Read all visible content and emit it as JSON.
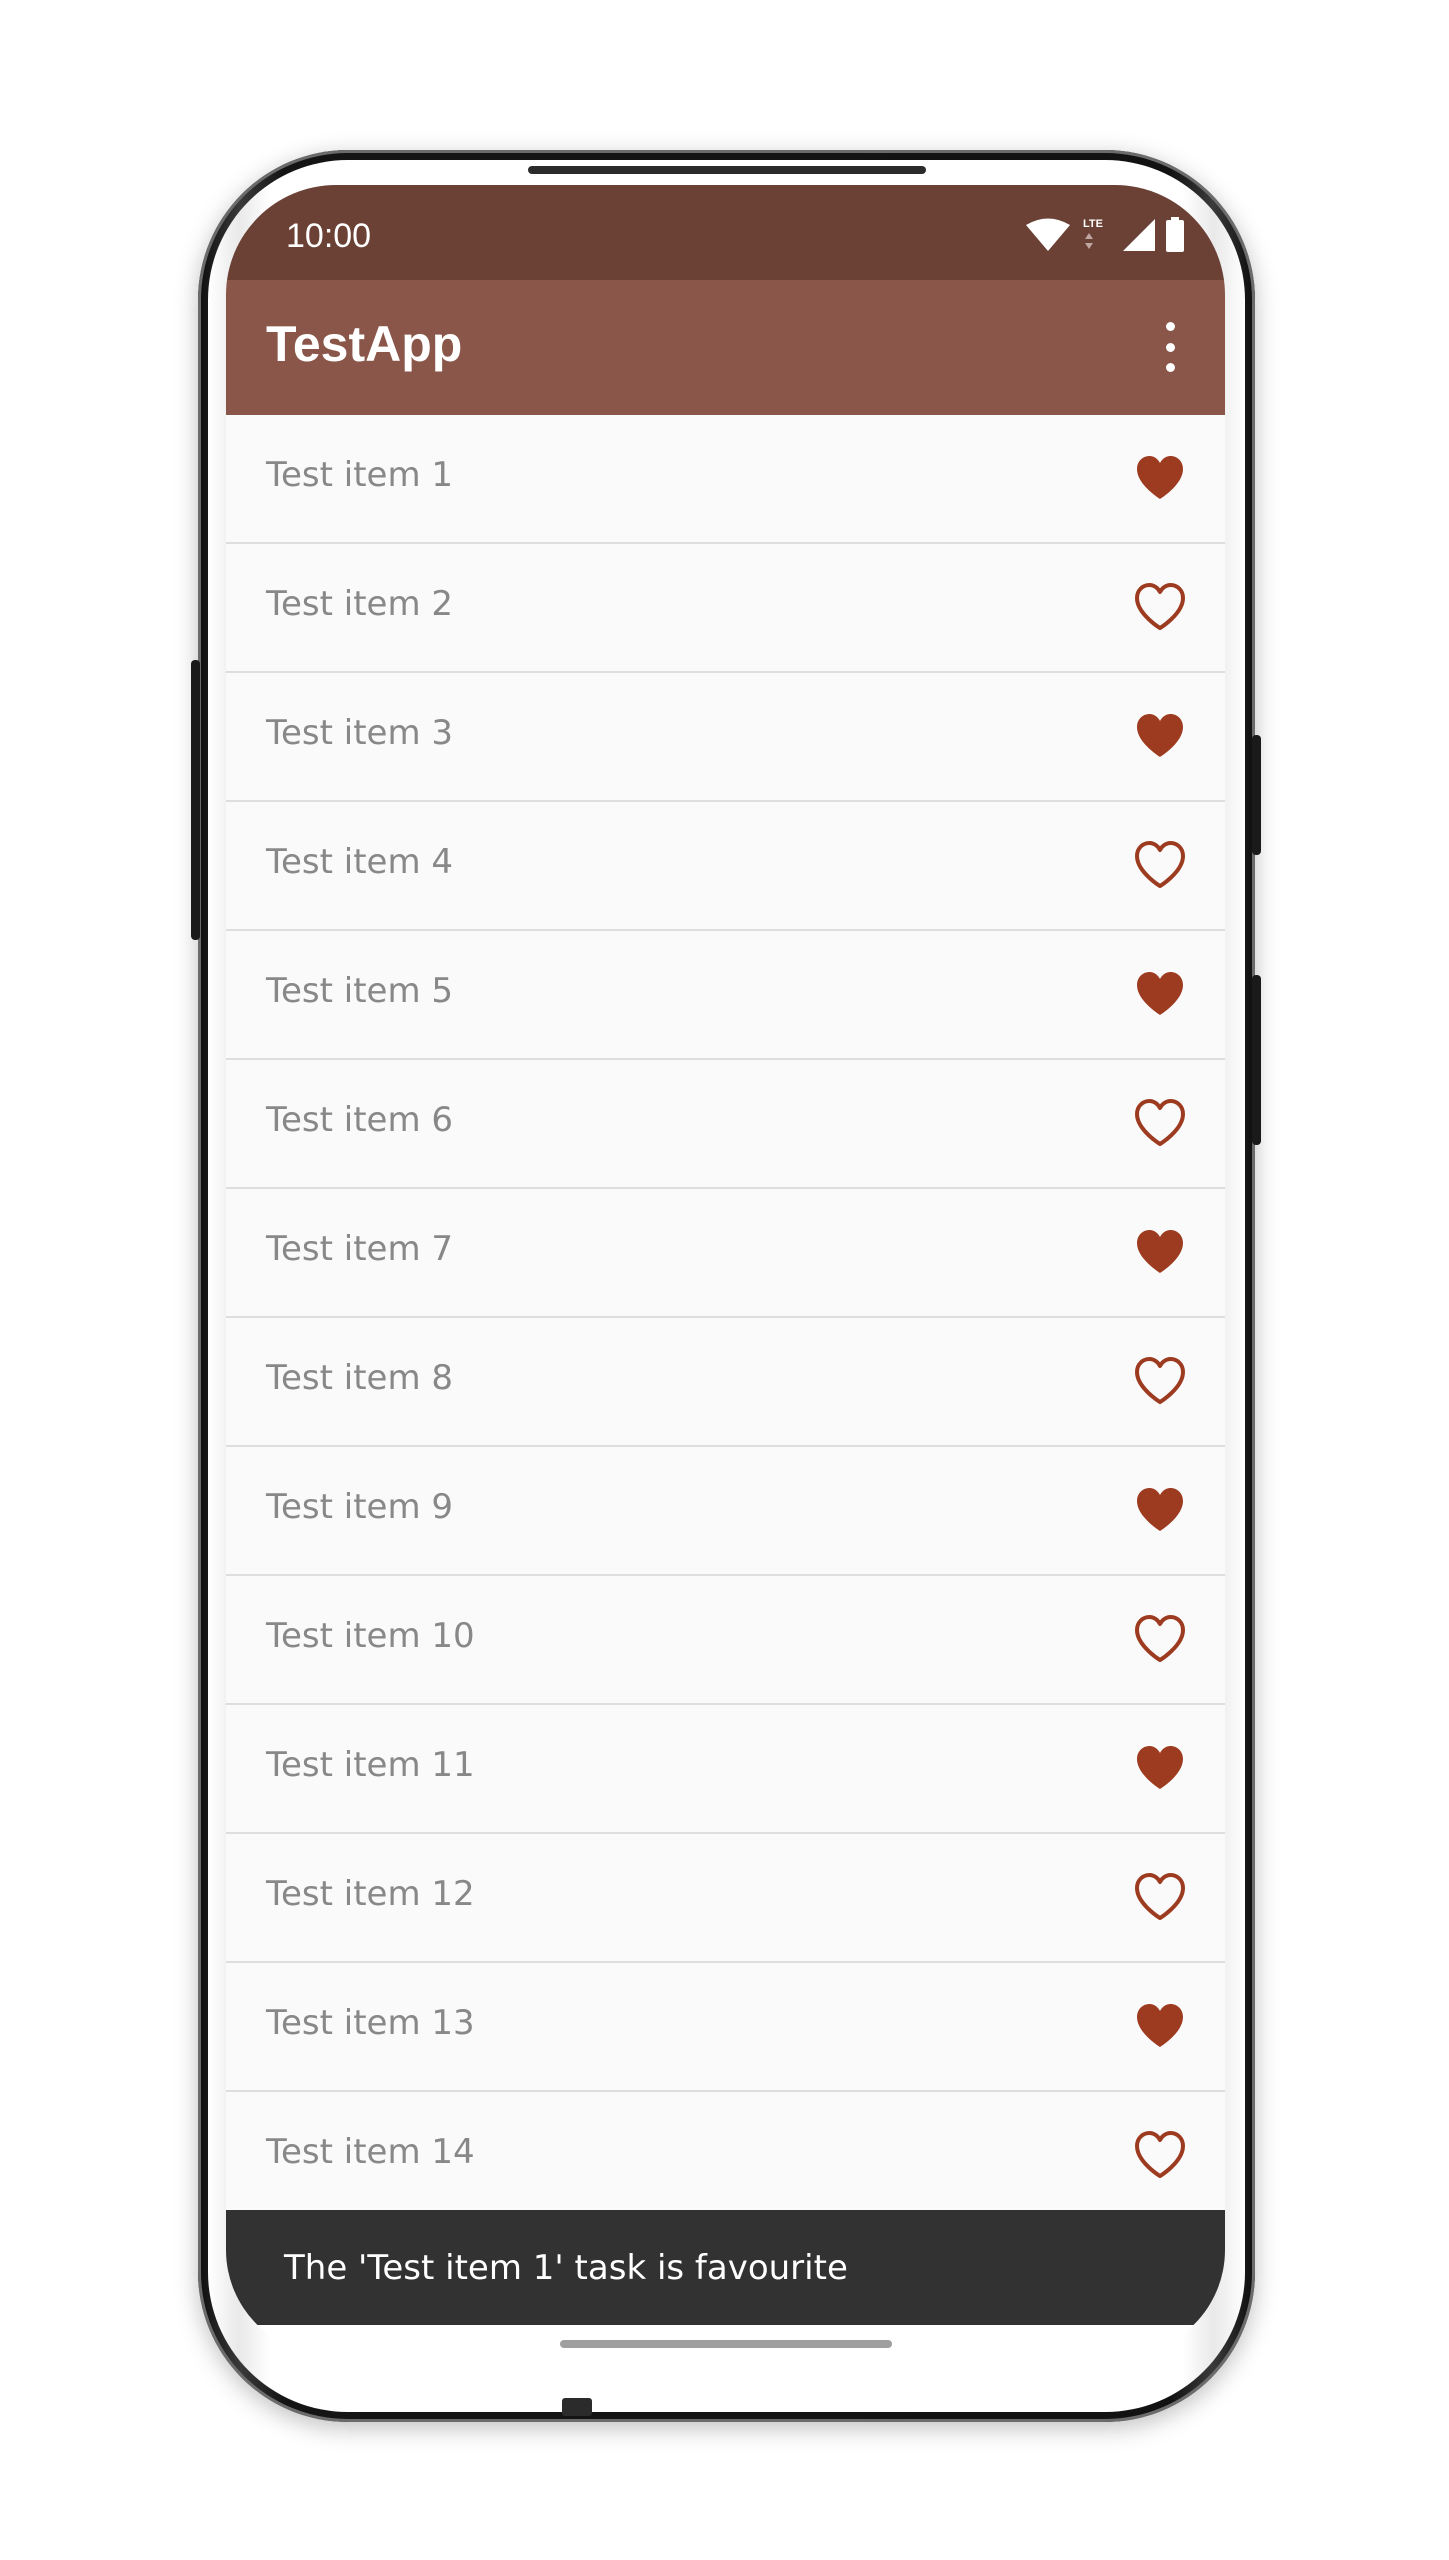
{
  "status_bar": {
    "time": "10:00",
    "icons": [
      "wifi-icon",
      "lte-icon",
      "signal-icon",
      "battery-icon"
    ],
    "network_label": "LTE"
  },
  "app_bar": {
    "title": "TestApp",
    "menu_icon": "more-vert-icon"
  },
  "colors": {
    "status_bar": "#6b4136",
    "app_bar": "#895649",
    "heart": "#9c3b1f",
    "snackbar": "#323232",
    "list_background": "#fafafa"
  },
  "list": {
    "items": [
      {
        "label": "Test item 1",
        "favourite": true
      },
      {
        "label": "Test item 2",
        "favourite": false
      },
      {
        "label": "Test item 3",
        "favourite": true
      },
      {
        "label": "Test item 4",
        "favourite": false
      },
      {
        "label": "Test item 5",
        "favourite": true
      },
      {
        "label": "Test item 6",
        "favourite": false
      },
      {
        "label": "Test item 7",
        "favourite": true
      },
      {
        "label": "Test item 8",
        "favourite": false
      },
      {
        "label": "Test item 9",
        "favourite": true
      },
      {
        "label": "Test item 10",
        "favourite": false
      },
      {
        "label": "Test item 11",
        "favourite": true
      },
      {
        "label": "Test item 12",
        "favourite": false
      },
      {
        "label": "Test item 13",
        "favourite": true
      },
      {
        "label": "Test item 14",
        "favourite": false
      }
    ]
  },
  "snackbar": {
    "message": "The 'Test item 1' task is favourite"
  }
}
